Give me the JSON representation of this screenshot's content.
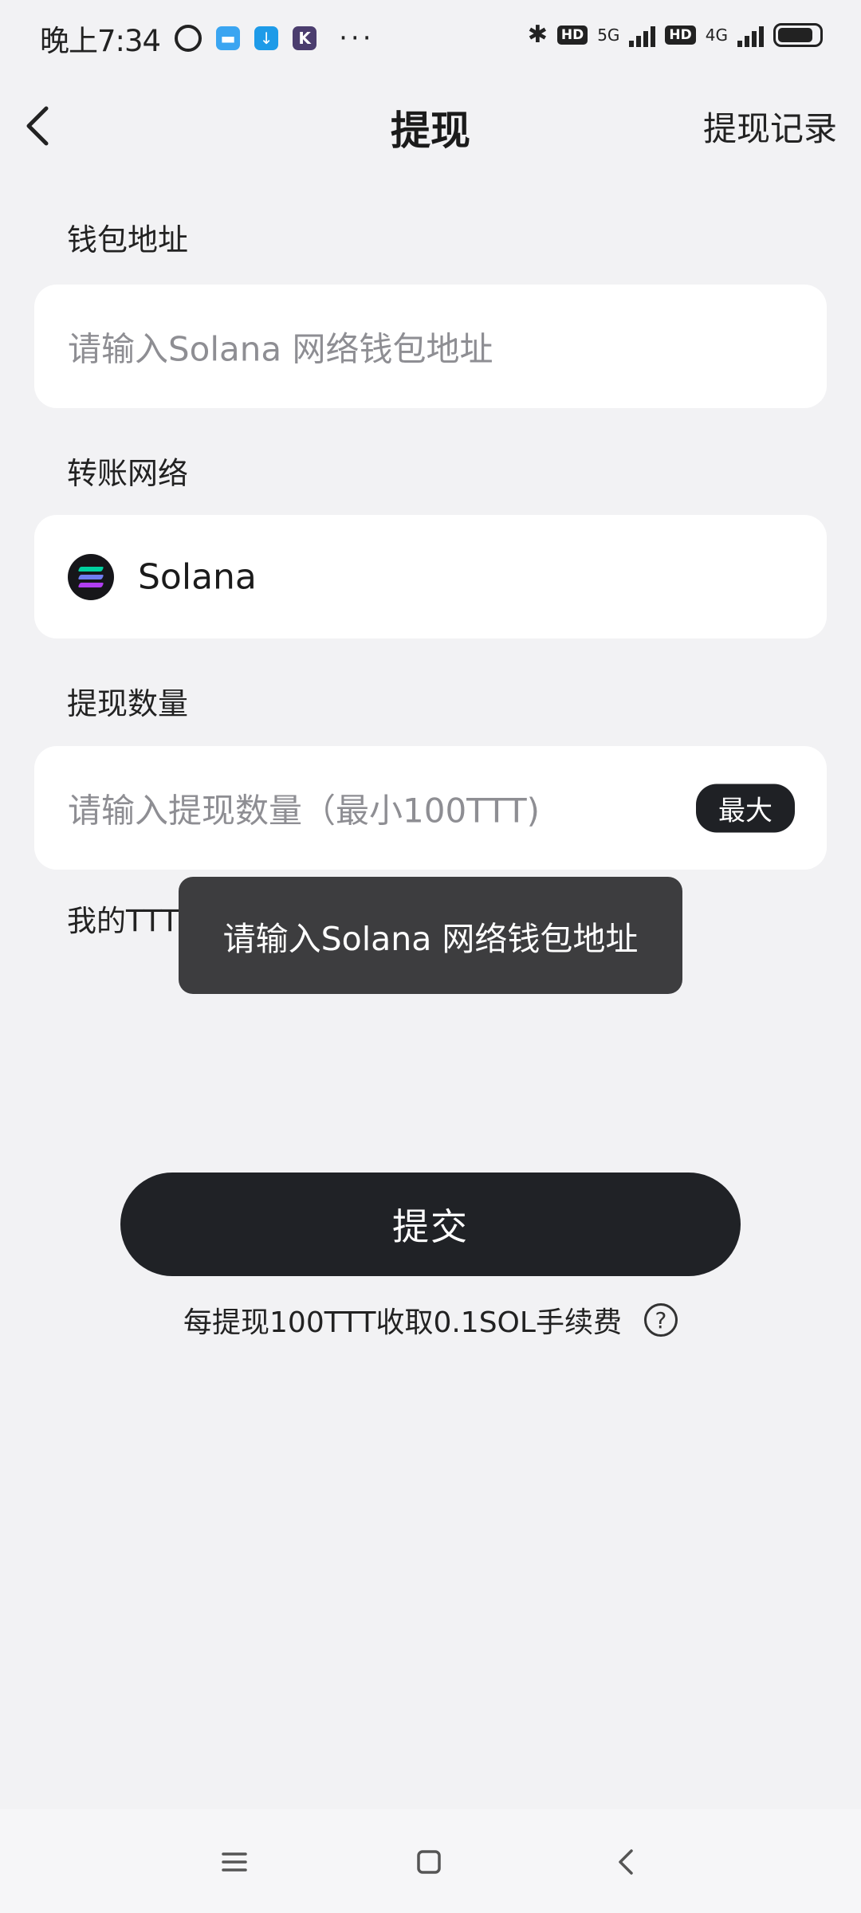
{
  "status_bar": {
    "time": "晚上7:34",
    "icons": [
      "alarm-icon",
      "chat-app-icon",
      "download-icon",
      "k-app-icon"
    ],
    "more": "···",
    "network_5g": "5G",
    "network_4g": "4G",
    "hd_label": "HD",
    "battery_level": 0.85
  },
  "header": {
    "title": "提现",
    "history_link": "提现记录"
  },
  "form": {
    "address": {
      "label": "钱包地址",
      "placeholder": "请输入Solana 网络钱包地址"
    },
    "network": {
      "label": "转账网络",
      "value": "Solana"
    },
    "amount": {
      "label": "提现数量",
      "placeholder": "请输入提现数量（最小100TTT)",
      "max_label": "最大"
    },
    "balance_text": "我的TTT余额：2974.15 TTT"
  },
  "toast": {
    "message": "请输入Solana 网络钱包地址"
  },
  "submit_label": "提交",
  "fee_note": "每提现100TTT收取0.1SOL手续费",
  "help_glyph": "?",
  "colors": {
    "background": "#f2f2f4",
    "card": "#ffffff",
    "primary_dark": "#202226",
    "placeholder": "#8e8e93",
    "toast": "#3d3d3f"
  }
}
